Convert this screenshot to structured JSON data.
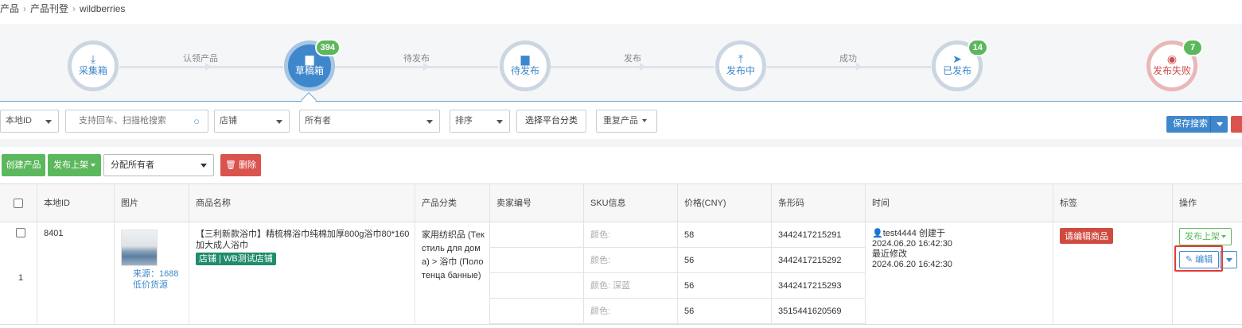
{
  "breadcrumb": {
    "items": [
      "产品",
      "产品刊登",
      "wildberries"
    ]
  },
  "steps": {
    "nodes": [
      {
        "label": "采集箱",
        "icon": "download-tray-icon",
        "glyph": "⤓",
        "badge": ""
      },
      {
        "label": "草稿箱",
        "icon": "folder-icon",
        "glyph": "▆",
        "badge": "394"
      },
      {
        "label": "待发布",
        "icon": "folder-icon",
        "glyph": "▆",
        "badge": ""
      },
      {
        "label": "发布中",
        "icon": "upload-tray-icon",
        "glyph": "⤒",
        "badge": ""
      },
      {
        "label": "已发布",
        "icon": "paper-plane-icon",
        "glyph": "➤",
        "badge": "14"
      },
      {
        "label": "发布失败",
        "icon": "eye-slash-icon",
        "glyph": "◉",
        "badge": "7"
      }
    ],
    "connectors": [
      "认领产品",
      "待发布",
      "发布",
      "成功"
    ]
  },
  "filters": {
    "local_id": "本地ID",
    "search_placeholder": "支持回车、扫描枪搜索",
    "store": "店铺",
    "owner": "所有者",
    "sort": "排序",
    "platform_category": "选择平台分类",
    "duplicate": "重复产品",
    "save_search": "保存搜索"
  },
  "actions": {
    "create": "创建产品",
    "publish": "发布上架",
    "assign": "分配所有者",
    "delete": "删除"
  },
  "table": {
    "headers": [
      "本地ID",
      "图片",
      "商品名称",
      "产品分类",
      "卖家编号",
      "SKU信息",
      "价格(CNY)",
      "条形码",
      "时间",
      "标签",
      "操作"
    ],
    "row": {
      "index": "1",
      "local_id": "8401",
      "source_line1": "来源：1688",
      "source_line2": "低价货源",
      "name": "【三利新款浴巾】精梳棉浴巾纯棉加厚800g浴巾80*160加大成人浴巾",
      "store_label": "店铺",
      "store_name": "WB测试店铺",
      "category": "家用纺织品 (Текстиль для дома) > 浴巾 (Полотенца банные)",
      "seller_code": "",
      "skus": [
        {
          "info": "颜色:",
          "price": "58",
          "barcode": "3442417215291"
        },
        {
          "info": "颜色:",
          "price": "56",
          "barcode": "3442417215292"
        },
        {
          "info": "颜色: 深蓝",
          "price": "56",
          "barcode": "3442417215293"
        },
        {
          "info": "颜色:",
          "price": "56",
          "barcode": "3515441620569"
        }
      ],
      "creator": "test4444 创建于",
      "created_at": "2024.06.20 16:42:30",
      "modified_label": "最近修改",
      "modified_at": "2024.06.20 16:42:30",
      "tag": "请编辑商品",
      "op_publish": "发布上架",
      "op_edit": "编辑"
    }
  },
  "colors": {
    "primary": "#3f87cc",
    "success": "#5cb85c",
    "danger": "#d9534f",
    "highlight": "#e53935"
  }
}
